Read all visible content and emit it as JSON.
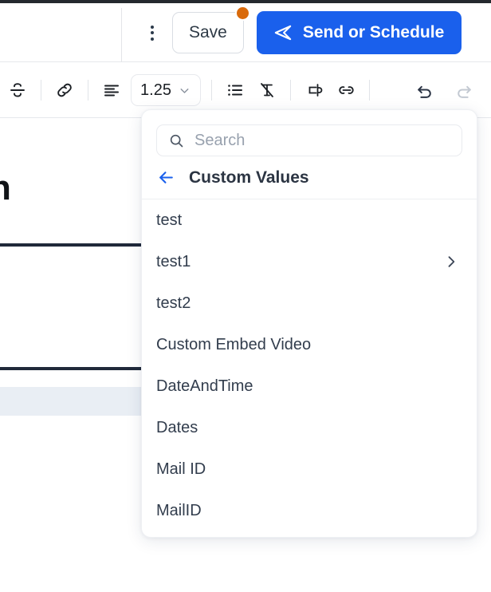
{
  "header": {
    "kebab_icon": "kebab-menu-icon",
    "save_label": "Save",
    "save_has_unsaved_badge": true,
    "send_label": "Send or Schedule",
    "send_icon": "paper-plane-icon",
    "accent_blue": "#1a60ec",
    "badge_orange": "#d96a0b"
  },
  "toolbar": {
    "items": [
      {
        "name": "strikethrough-icon",
        "label": "Strikethrough"
      },
      {
        "name": "link-icon",
        "label": "Insert link"
      },
      {
        "name": "align-left-icon",
        "label": "Alignment"
      },
      {
        "name": "bulleted-list-icon",
        "label": "Bulleted list"
      },
      {
        "name": "clear-formatting-icon",
        "label": "Clear formatting"
      },
      {
        "name": "button-element-icon",
        "label": "Insert button"
      },
      {
        "name": "merge-tag-icon",
        "label": "Custom values"
      },
      {
        "name": "undo-icon",
        "label": "Undo"
      },
      {
        "name": "redo-icon",
        "label": "Redo"
      }
    ],
    "line_height_value": "1.25",
    "line_height_chevron": "chevron-down-icon",
    "undo_enabled": true,
    "redo_enabled": false
  },
  "document": {
    "heading_fragment": "h"
  },
  "dropdown": {
    "search": {
      "placeholder": "Search",
      "value": "",
      "icon": "search-icon"
    },
    "back": {
      "icon": "arrow-left-icon",
      "label": "Custom Values"
    },
    "items": [
      {
        "label": "test",
        "has_submenu": false
      },
      {
        "label": "test1",
        "has_submenu": true
      },
      {
        "label": "test2",
        "has_submenu": false
      },
      {
        "label": "Custom Embed Video",
        "has_submenu": false
      },
      {
        "label": "DateAndTime",
        "has_submenu": false
      },
      {
        "label": "Dates",
        "has_submenu": false
      },
      {
        "label": "Mail ID",
        "has_submenu": false
      },
      {
        "label": "MailID",
        "has_submenu": false
      }
    ]
  }
}
